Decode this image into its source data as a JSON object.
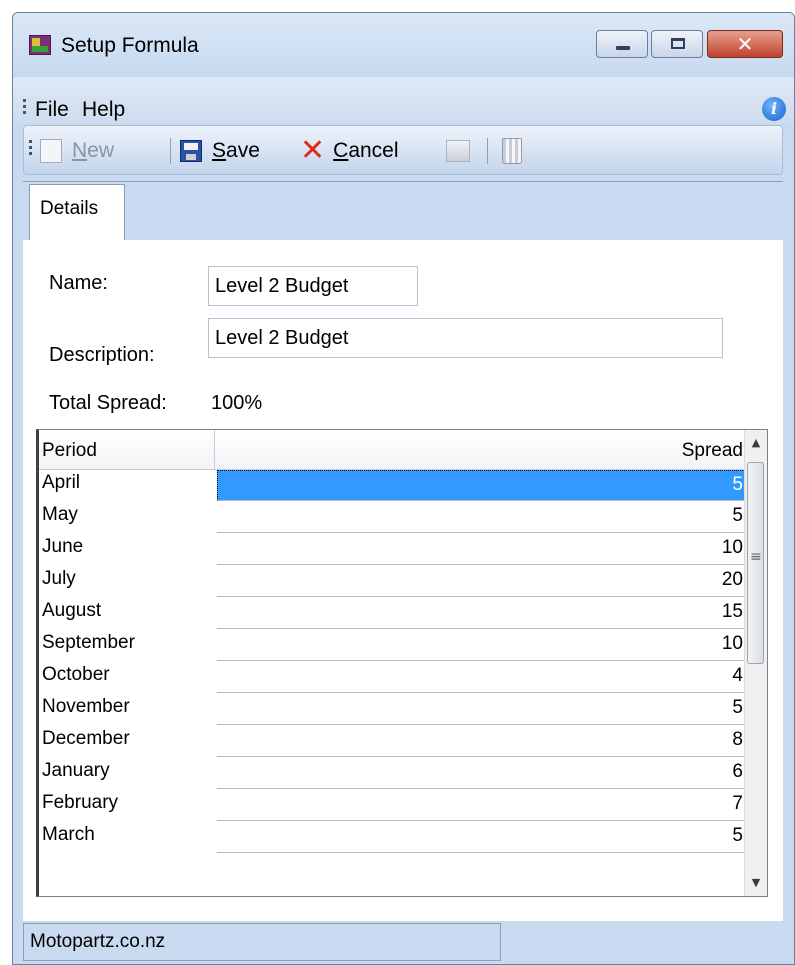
{
  "window": {
    "title": "Setup Formula"
  },
  "menu": {
    "file": "File",
    "help": "Help"
  },
  "toolbar": {
    "new_label": "New",
    "new_accel": "N",
    "new_rest": "ew",
    "save_accel": "S",
    "save_rest": "ave",
    "cancel_accel": "C",
    "cancel_rest": "ancel"
  },
  "tabs": {
    "details": "Details"
  },
  "form": {
    "name_label": "Name:",
    "name_value": "Level 2 Budget",
    "description_label": "Description:",
    "description_value": "Level 2 Budget",
    "total_spread_label": "Total Spread:",
    "total_spread_value": "100%"
  },
  "grid": {
    "columns": [
      "Period",
      "Spread"
    ],
    "rows": [
      {
        "period": "April",
        "spread": "5"
      },
      {
        "period": "May",
        "spread": "5"
      },
      {
        "period": "June",
        "spread": "10"
      },
      {
        "period": "July",
        "spread": "20"
      },
      {
        "period": "August",
        "spread": "15"
      },
      {
        "period": "September",
        "spread": "10"
      },
      {
        "period": "October",
        "spread": "4"
      },
      {
        "period": "November",
        "spread": "5"
      },
      {
        "period": "December",
        "spread": "8"
      },
      {
        "period": "January",
        "spread": "6"
      },
      {
        "period": "February",
        "spread": "7"
      },
      {
        "period": "March",
        "spread": "5"
      }
    ]
  },
  "status": {
    "company": "Motopartz.co.nz"
  },
  "colors": {
    "selection": "#3399ff",
    "close_button": "#c0432e",
    "cancel_icon": "#e02a1a",
    "frame": "#c9daf0"
  }
}
